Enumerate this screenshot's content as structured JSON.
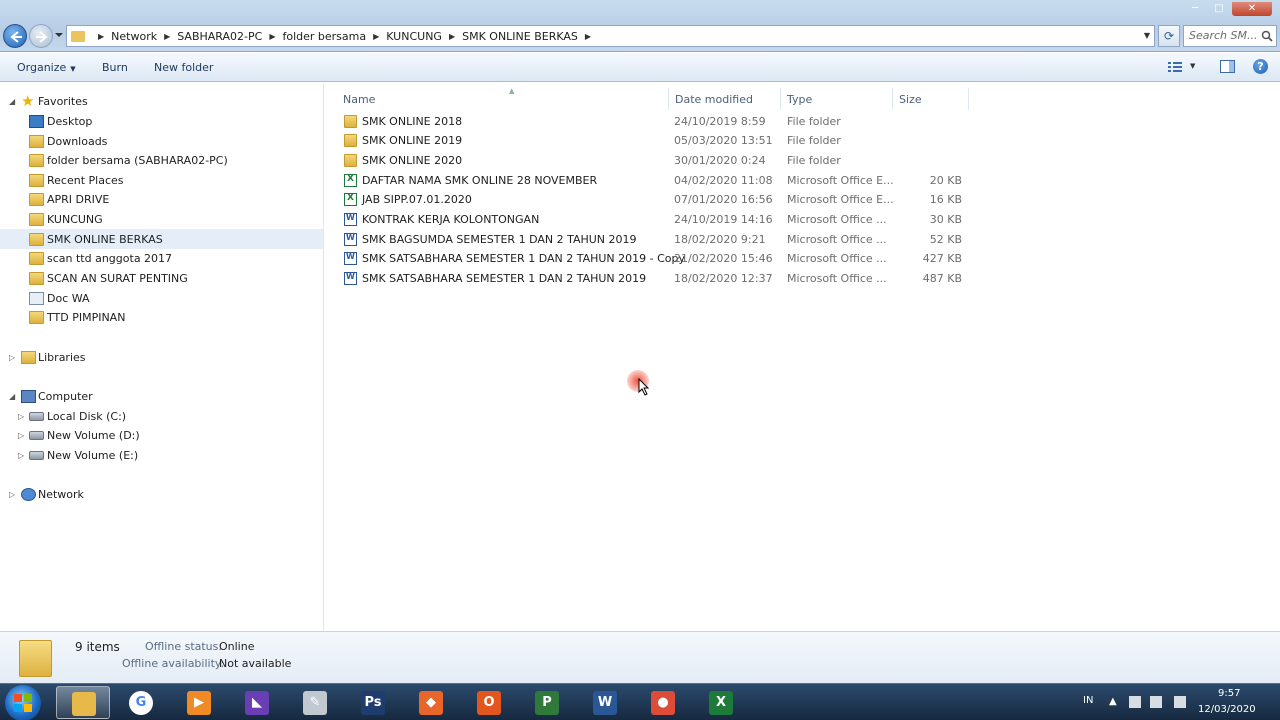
{
  "window": {
    "breadcrumbs": [
      "Network",
      "SABHARA02-PC",
      "folder bersama",
      "KUNCUNG",
      "SMK ONLINE BERKAS"
    ],
    "search_placeholder": "Search SM...",
    "controls": {
      "minimize": "─",
      "maximize": "□",
      "close": "✕"
    }
  },
  "toolbar": {
    "organize_label": "Organize",
    "burn_label": "Burn",
    "new_folder_label": "New folder"
  },
  "nav": {
    "favorites_label": "Favorites",
    "favorites": [
      {
        "label": "Desktop",
        "icon": "desktop-icon"
      },
      {
        "label": "Downloads",
        "icon": "downloads-icon"
      },
      {
        "label": "folder bersama (SABHARA02-PC)",
        "icon": "folder-icon"
      },
      {
        "label": "Recent Places",
        "icon": "recent-places-icon"
      },
      {
        "label": "APRI DRIVE",
        "icon": "folder-icon"
      },
      {
        "label": "KUNCUNG",
        "icon": "folder-icon"
      },
      {
        "label": "SMK ONLINE BERKAS",
        "icon": "folder-icon",
        "selected": true
      },
      {
        "label": "scan ttd anggota 2017",
        "icon": "folder-icon"
      },
      {
        "label": "SCAN AN SURAT PENTING",
        "icon": "folder-icon"
      },
      {
        "label": "Doc WA",
        "icon": "document-icon"
      },
      {
        "label": "TTD PIMPINAN",
        "icon": "folder-icon"
      }
    ],
    "libraries_label": "Libraries",
    "computer_label": "Computer",
    "drives": [
      {
        "label": "Local Disk (C:)"
      },
      {
        "label": "New Volume (D:)"
      },
      {
        "label": "New Volume (E:)"
      }
    ],
    "network_label": "Network"
  },
  "columns": {
    "name": "Name",
    "date": "Date modified",
    "type": "Type",
    "size": "Size"
  },
  "files": [
    {
      "name": "SMK ONLINE 2018",
      "date": "24/10/2019 8:59",
      "type": "File folder",
      "size": "",
      "icon": "folder"
    },
    {
      "name": "SMK ONLINE 2019",
      "date": "05/03/2020 13:51",
      "type": "File folder",
      "size": "",
      "icon": "folder"
    },
    {
      "name": "SMK ONLINE 2020",
      "date": "30/01/2020 0:24",
      "type": "File folder",
      "size": "",
      "icon": "folder"
    },
    {
      "name": "DAFTAR NAMA SMK ONLINE 28 NOVEMBER",
      "date": "04/02/2020 11:08",
      "type": "Microsoft Office E...",
      "size": "20 KB",
      "icon": "excel"
    },
    {
      "name": "JAB SIPP.07.01.2020",
      "date": "07/01/2020 16:56",
      "type": "Microsoft Office E...",
      "size": "16 KB",
      "icon": "excel"
    },
    {
      "name": "KONTRAK KERJA KOLONTONGAN",
      "date": "24/10/2019 14:16",
      "type": "Microsoft Office ...",
      "size": "30 KB",
      "icon": "word"
    },
    {
      "name": "SMK BAGSUMDA SEMESTER 1 DAN 2 TAHUN 2019",
      "date": "18/02/2020 9:21",
      "type": "Microsoft Office ...",
      "size": "52 KB",
      "icon": "word"
    },
    {
      "name": "SMK SATSABHARA SEMESTER 1 DAN 2 TAHUN 2019 - Copy",
      "date": "21/02/2020 15:46",
      "type": "Microsoft Office ...",
      "size": "427 KB",
      "icon": "word"
    },
    {
      "name": "SMK SATSABHARA SEMESTER 1 DAN 2 TAHUN 2019",
      "date": "18/02/2020 12:37",
      "type": "Microsoft Office ...",
      "size": "487 KB",
      "icon": "word"
    }
  ],
  "details": {
    "count": "9 items",
    "offline_status_label": "Offline status:",
    "offline_status_value": "Online",
    "offline_avail_label": "Offline availability:",
    "offline_avail_value": "Not available"
  },
  "taskbar": {
    "apps": [
      {
        "name": "windows-explorer",
        "glyph": "",
        "color": "#e6b94a",
        "active": true
      },
      {
        "name": "google",
        "glyph": "G",
        "color": "#ffffff"
      },
      {
        "name": "media-player",
        "glyph": "▶",
        "color": "#f08a24"
      },
      {
        "name": "visual-studio",
        "glyph": "◣",
        "color": "#6a3fb5"
      },
      {
        "name": "paint-tool",
        "glyph": "✎",
        "color": "#c0c8d0"
      },
      {
        "name": "photoshop",
        "glyph": "Ps",
        "color": "#1e3c6e"
      },
      {
        "name": "browser-alt",
        "glyph": "◆",
        "color": "#e8662a"
      },
      {
        "name": "office",
        "glyph": "O",
        "color": "#e2571e"
      },
      {
        "name": "project",
        "glyph": "P",
        "color": "#2f7a3b"
      },
      {
        "name": "word",
        "glyph": "W",
        "color": "#2b5797"
      },
      {
        "name": "chrome",
        "glyph": "●",
        "color": "#dd4b39"
      },
      {
        "name": "excel",
        "glyph": "X",
        "color": "#1d7a3b"
      }
    ],
    "lang": "IN",
    "time": "9:57",
    "date": "12/03/2020"
  },
  "colors": {
    "selection": "#e5eef8",
    "accent": "#1e395b"
  }
}
